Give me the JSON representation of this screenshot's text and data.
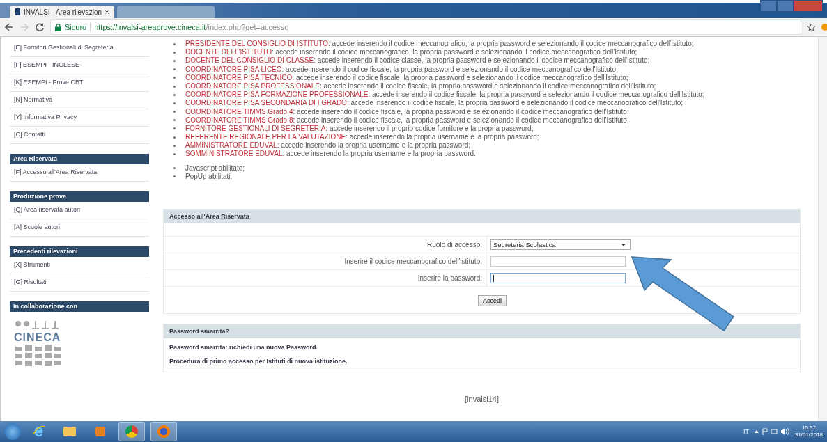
{
  "browser": {
    "tabs": [
      {
        "title": "INVALSI - Area rilevazion",
        "selected": true
      },
      {
        "selected": false
      }
    ],
    "secure_label": "Sicuro",
    "url_host": "https://invalsi-areaprove.cineca.it",
    "url_path": "/index.php?get=accesso"
  },
  "sidebar": {
    "items": [
      {
        "label": "[E] Fornitori Gestionali di Segreteria"
      },
      {
        "label": "[F] ESEMPI - INGLESE"
      },
      {
        "label": "[K] ESEMPI - Prove CBT"
      },
      {
        "label": "[N] Normativa"
      },
      {
        "label": "[Y] Informativa Privacy"
      },
      {
        "label": "[C] Contatti"
      }
    ],
    "sections": [
      {
        "title": "Area Riservata",
        "items": [
          {
            "label": "[F] Accesso all'Area Riservata"
          }
        ]
      },
      {
        "title": "Produzione prove",
        "items": [
          {
            "label": "[Q] Area riservata autori"
          },
          {
            "label": "[A] Scuole autori"
          }
        ]
      },
      {
        "title": "Precedenti rilevazioni",
        "items": [
          {
            "label": "[X] Strumenti"
          },
          {
            "label": "[G] Risultati"
          }
        ]
      },
      {
        "title": "In collaborazione con"
      }
    ],
    "partner_logo_text": "CINECA"
  },
  "access_roles": [
    {
      "role": "PRESIDENTE DEL CONSIGLIO DI ISTITUTO",
      "text": ": accede inserendo il codice meccanografico, la propria password e selezionando il codice meccanografico dell'Istituto;"
    },
    {
      "role": "DOCENTE DELL'ISTITUTO",
      "text": ": accede inserendo il codice meccanografico, la propria password e selezionando il codice meccanografico dell'Istituto;"
    },
    {
      "role": "DOCENTE DEL CONSIGLIO DI CLASSE",
      "text": ": accede inserendo il codice classe, la propria password e selezionando il codice meccanografico dell'Istituto;"
    },
    {
      "role": "COORDINATORE PISA LICEO",
      "text": ": accede inserendo il codice fiscale, la propria password e selezionando il codice meccanografico dell'Istituto;"
    },
    {
      "role": "COORDINATORE PISA TECNICO",
      "text": ": accede inserendo il codice fiscale, la propria password e selezionando il codice meccanografico dell'Istituto;"
    },
    {
      "role": "COORDINATORE PISA PROFESSIONALE",
      "text": ": accede inserendo il codice fiscale, la propria password e selezionando il codice meccanografico dell'Istituto;"
    },
    {
      "role": "COORDINATORE PISA FORMAZIONE PROFESSIONALE",
      "text": ": accede inserendo il codice fiscale, la propria password e selezionando il codice meccanografico dell'Istituto;"
    },
    {
      "role": "COORDINATORE PISA SECONDARIA DI I GRADO",
      "text": ": accede inserendo il codice fiscale, la propria password e selezionando il codice meccanografico dell'Istituto;"
    },
    {
      "role": "COORDINATORE TIMMS Grado 4",
      "text": ": accede inserendo il codice fiscale, la propria password e selezionando il codice meccanografico dell'Istituto;"
    },
    {
      "role": "COORDINATORE TIMMS Grado 8",
      "text": ": accede inserendo il codice fiscale, la propria password e selezionando il codice meccanografico dell'Istituto;"
    },
    {
      "role": "FORNITORE GESTIONALI DI SEGRETERIA",
      "text": ": accede inserendo il proprio codice fornitore e la propria password;"
    },
    {
      "role": "REFERENTE REGIONALE PER LA VALUTAZIONE",
      "text": ": accede inserendo la propria username e la propria password;"
    },
    {
      "role": "AMMINISTRATORE EDUVAL",
      "text": ": accede inserendo la propria username e la propria password;"
    },
    {
      "role": "SOMMINISTRATORE EDUVAL",
      "text": ": accede inserendo la propria username e la propria password."
    }
  ],
  "requirements": [
    "Javascript abilitato;",
    "PopUp abilitati."
  ],
  "login_panel": {
    "title": "Accesso all'Area Riservata",
    "role_label": "Ruolo di accesso:",
    "role_value": "Segreteria Scolastica",
    "code_label": "Inserire il codice meccanografico dell'istituto:",
    "password_label": "Inserire la password:",
    "submit": "Accedi"
  },
  "lost_password_panel": {
    "title": "Password smarrita?",
    "links": [
      "Password smarrita: richiedi una nuova Password.",
      "Procedura di primo accesso per Istituti di nuova istituzione."
    ]
  },
  "footer": "[invalsi14]",
  "taskbar": {
    "language": "IT",
    "time": "15:37",
    "date": "31/01/2018"
  }
}
